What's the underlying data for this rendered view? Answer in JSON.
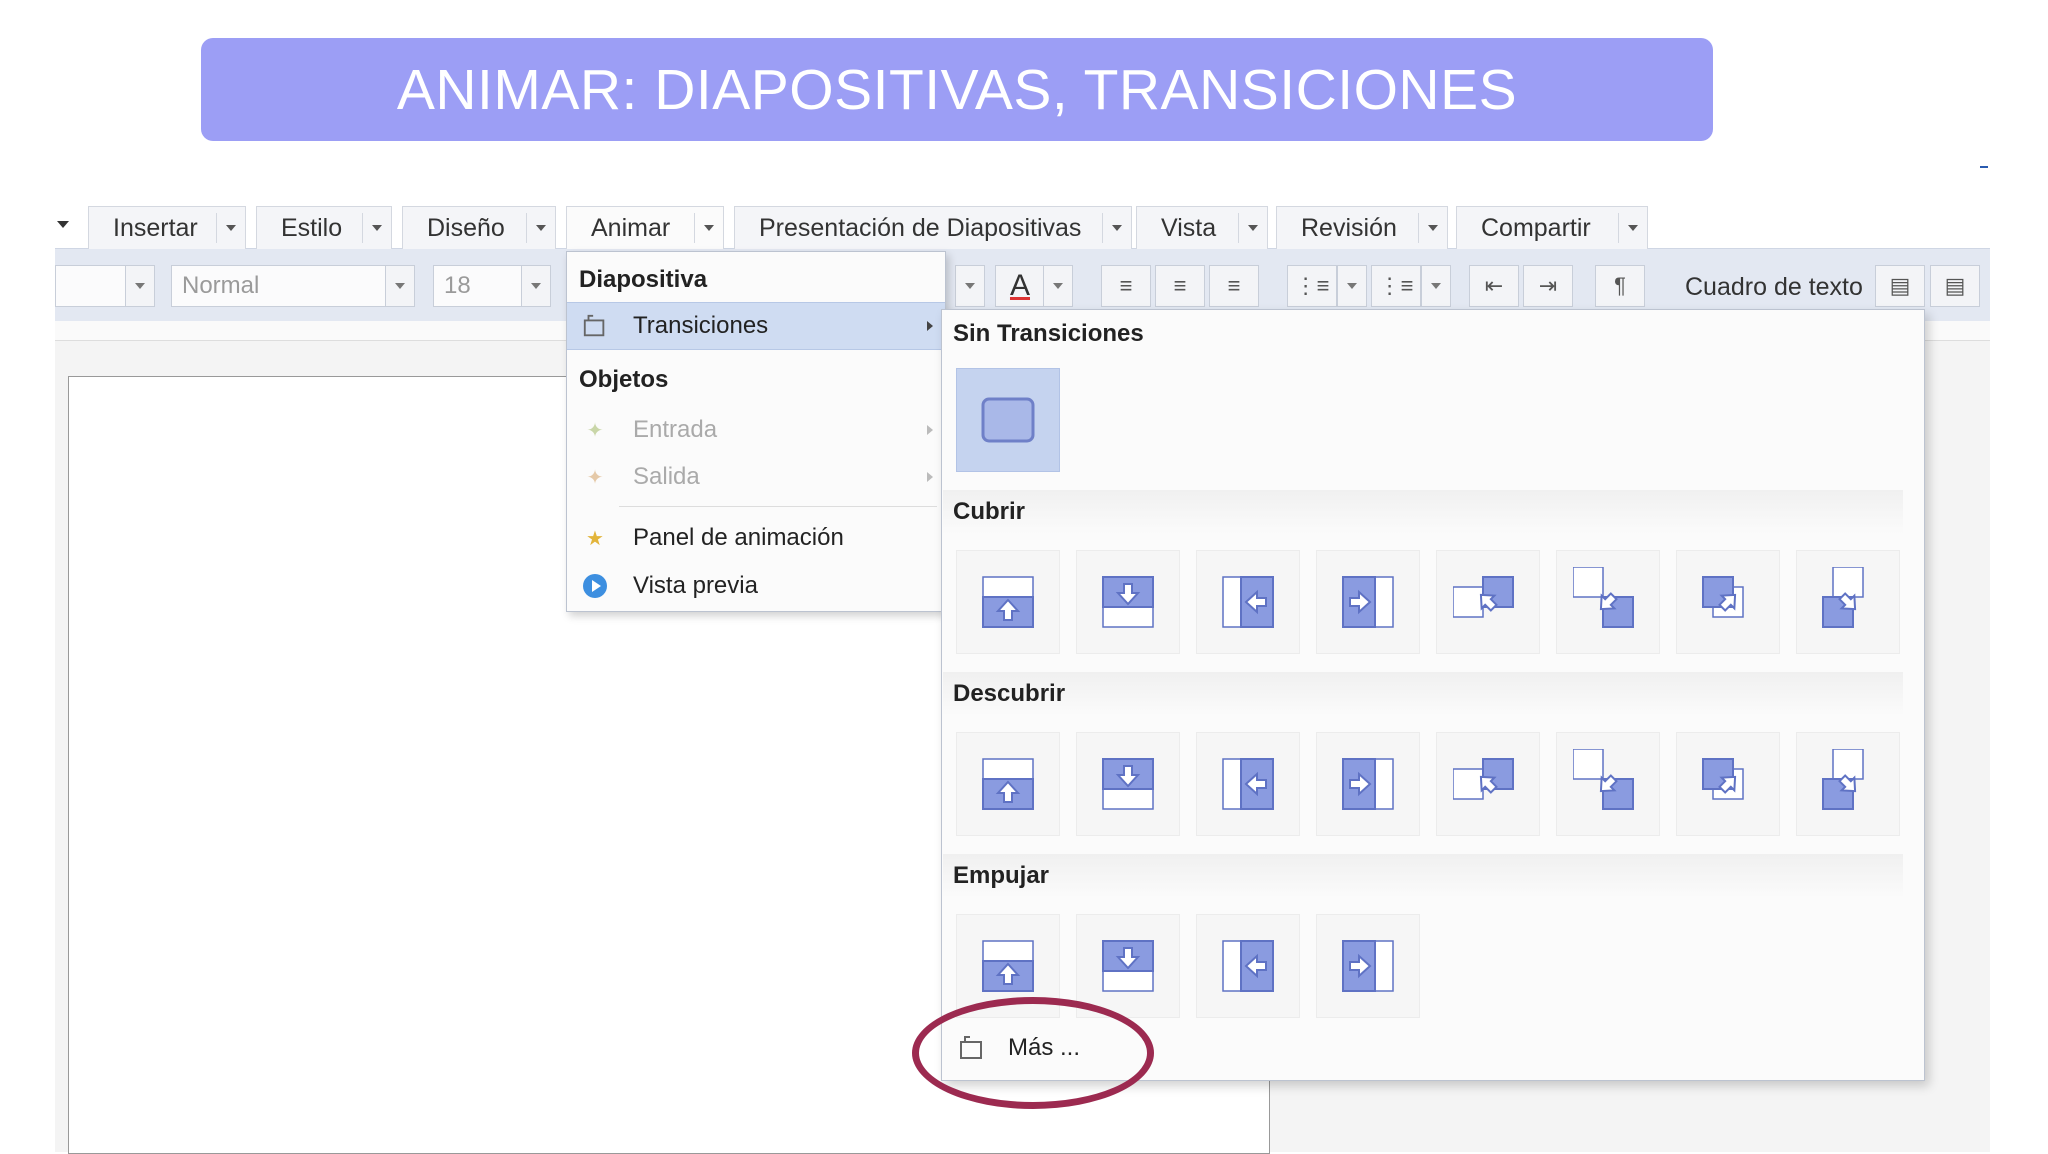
{
  "banner": {
    "title": "ANIMAR: DIAPOSITIVAS, TRANSICIONES"
  },
  "tabs": [
    {
      "label": "Insertar"
    },
    {
      "label": "Estilo"
    },
    {
      "label": "Diseño"
    },
    {
      "label": "Animar"
    },
    {
      "label": "Presentación de Diapositivas"
    },
    {
      "label": "Vista"
    },
    {
      "label": "Revisión"
    },
    {
      "label": "Compartir"
    }
  ],
  "toolbar": {
    "style_value": "Normal",
    "size_value": "18",
    "font_color_glyph": "A",
    "textbox_label": "Cuadro de texto"
  },
  "animar_menu": {
    "section_slide": "Diapositiva",
    "transitions": "Transiciones",
    "section_objects": "Objetos",
    "entrada": "Entrada",
    "salida": "Salida",
    "panel": "Panel de animación",
    "preview": "Vista previa"
  },
  "transitions_menu": {
    "none_header": "Sin Transiciones",
    "cover_header": "Cubrir",
    "uncover_header": "Descubrir",
    "push_header": "Empujar",
    "more": "Más ..."
  },
  "colors": {
    "banner": "#9c9ef5",
    "highlight": "#cfdcf2",
    "icon_fill": "#7d8fd6",
    "annotation": "#9c2a50"
  }
}
